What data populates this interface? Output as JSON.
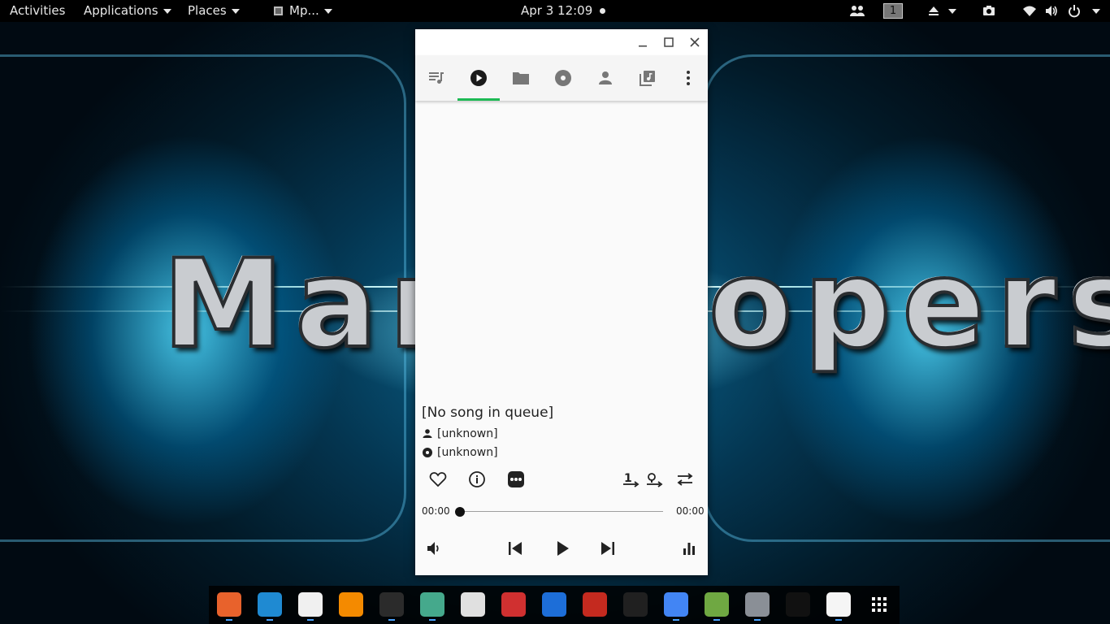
{
  "topbar": {
    "activities": "Activities",
    "applications": "Applications",
    "places": "Places",
    "app_menu": "Mp...",
    "clock": "Apr 3  12:09",
    "workspace": "1",
    "icons": [
      "people-icon",
      "workspace-indicator",
      "eject-icon",
      "screenshot-icon",
      "wifi-icon",
      "volume-icon",
      "power-icon"
    ]
  },
  "wallpaper": {
    "text_left": "Mart",
    "text_right": "opers"
  },
  "window": {
    "controls": [
      "minimize-icon",
      "maximize-icon",
      "close-icon"
    ],
    "tabs": [
      {
        "name": "queue",
        "icon": "queue-music-icon"
      },
      {
        "name": "now-playing",
        "icon": "play-circle-icon",
        "active": true
      },
      {
        "name": "files",
        "icon": "folder-icon"
      },
      {
        "name": "albums",
        "icon": "disc-icon"
      },
      {
        "name": "artists",
        "icon": "person-icon"
      },
      {
        "name": "playlists",
        "icon": "library-music-icon"
      }
    ],
    "accent": "#1db954",
    "song": {
      "title": "[No song in queue]",
      "artist": "[unknown]",
      "album": "[unknown]"
    },
    "time_elapsed": "00:00",
    "time_total": "00:00",
    "progress": 0
  },
  "dock": {
    "apps": [
      {
        "name": "firefox",
        "color": "#e8622c"
      },
      {
        "name": "vscode",
        "color": "#1f8ad2"
      },
      {
        "name": "files",
        "color": "#f0f0f0"
      },
      {
        "name": "vlc",
        "color": "#f48a00"
      },
      {
        "name": "terminal",
        "color": "#2b2b2b"
      },
      {
        "name": "atom",
        "color": "#45a98c"
      },
      {
        "name": "app-red-white",
        "color": "#e0e0e0"
      },
      {
        "name": "app-red-diamond",
        "color": "#d03030"
      },
      {
        "name": "teamviewer",
        "color": "#1d6ed8"
      },
      {
        "name": "filezilla",
        "color": "#c42a1f"
      },
      {
        "name": "kde-connect",
        "color": "#202020"
      },
      {
        "name": "chrome",
        "color": "#4285f4"
      },
      {
        "name": "android-studio",
        "color": "#6fa842"
      },
      {
        "name": "virtualbox",
        "color": "#8a8f96"
      },
      {
        "name": "phone",
        "color": "#111111"
      },
      {
        "name": "app-white-circle",
        "color": "#f5f5f5"
      },
      {
        "name": "show-apps",
        "color": "#000000"
      }
    ]
  }
}
